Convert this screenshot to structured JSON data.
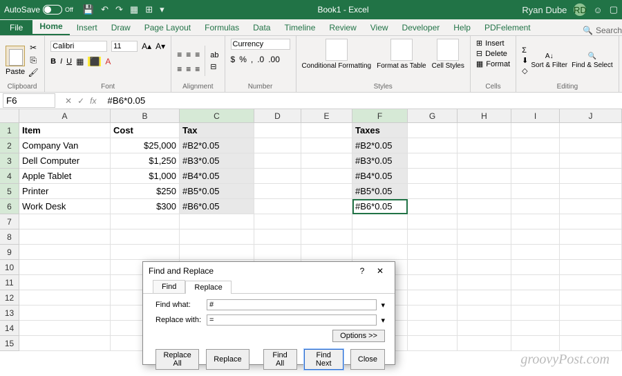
{
  "titlebar": {
    "autosave_label": "AutoSave",
    "autosave_state": "Off",
    "title": "Book1 - Excel",
    "user": "Ryan Dube",
    "user_initials": "RD"
  },
  "tabs": {
    "file": "File",
    "home": "Home",
    "insert": "Insert",
    "draw": "Draw",
    "page_layout": "Page Layout",
    "formulas": "Formulas",
    "data": "Data",
    "timeline": "Timeline",
    "review": "Review",
    "view": "View",
    "developer": "Developer",
    "help": "Help",
    "pdf": "PDFelement",
    "search": "Search"
  },
  "ribbon": {
    "clipboard": {
      "paste": "Paste",
      "label": "Clipboard"
    },
    "font": {
      "name": "Calibri",
      "size": "11",
      "label": "Font"
    },
    "alignment": {
      "wrap": "Wrap Text",
      "merge": "Merge & Center",
      "label": "Alignment"
    },
    "number": {
      "format": "Currency",
      "label": "Number"
    },
    "styles": {
      "cond": "Conditional Formatting",
      "table": "Format as Table",
      "cell": "Cell Styles",
      "label": "Styles"
    },
    "cells": {
      "insert": "Insert",
      "delete": "Delete",
      "format": "Format",
      "label": "Cells"
    },
    "editing": {
      "sort": "Sort & Filter",
      "find": "Find & Select",
      "label": "Editing"
    }
  },
  "formula_bar": {
    "cell_ref": "F6",
    "formula": "#B6*0.05"
  },
  "grid": {
    "columns": [
      "A",
      "B",
      "C",
      "D",
      "E",
      "F",
      "G",
      "H",
      "I",
      "J"
    ],
    "row_count": 15,
    "headers": {
      "A": "Item",
      "B": "Cost",
      "C": "Tax",
      "F": "Taxes"
    },
    "data": [
      {
        "A": "Company Van",
        "B": "$25,000",
        "C": "#B2*0.05",
        "F": "#B2*0.05"
      },
      {
        "A": "Dell Computer",
        "B": "$1,250",
        "C": "#B3*0.05",
        "F": "#B3*0.05"
      },
      {
        "A": "Apple Tablet",
        "B": "$1,000",
        "C": "#B4*0.05",
        "F": "#B4*0.05"
      },
      {
        "A": "Printer",
        "B": "$250",
        "C": "#B5*0.05",
        "F": "#B5*0.05"
      },
      {
        "A": "Work Desk",
        "B": "$300",
        "C": "#B6*0.05",
        "F": "#B6*0.05"
      }
    ]
  },
  "dialog": {
    "title": "Find and Replace",
    "tab_find": "Find",
    "tab_replace": "Replace",
    "find_label": "Find what:",
    "find_value": "#",
    "replace_label": "Replace with:",
    "replace_value": "=",
    "options": "Options >>",
    "replace_all": "Replace All",
    "replace": "Replace",
    "find_all": "Find All",
    "find_next": "Find Next",
    "close": "Close"
  },
  "watermark": "groovyPost.com"
}
